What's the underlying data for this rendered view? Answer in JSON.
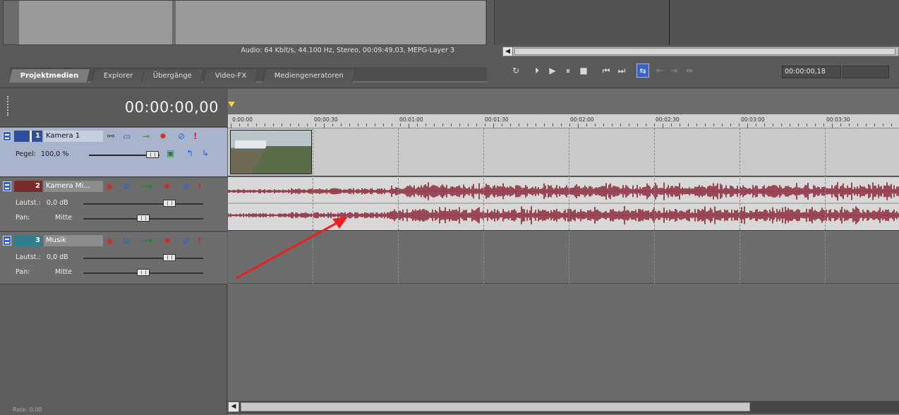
{
  "media": {
    "info": "Audio: 64 Kbit/s, 44.100 Hz, Stereo, 00:09:49,03, MEPG-Layer 3",
    "tabs": [
      {
        "label": "Projektmedien",
        "active": true
      },
      {
        "label": "Explorer",
        "active": false
      },
      {
        "label": "Übergänge",
        "active": false
      },
      {
        "label": "Video-FX",
        "active": false
      },
      {
        "label": "Mediengeneratoren",
        "active": false
      }
    ]
  },
  "preview": {
    "scroll_left_icon": "scroll-left-arrow-icon"
  },
  "transport": {
    "buttons": [
      {
        "name": "loop-playback-icon",
        "glyph": "↻"
      },
      {
        "name": "play-from-start-icon",
        "glyph": "⏵"
      },
      {
        "name": "play-icon",
        "glyph": "▶"
      },
      {
        "name": "pause-icon",
        "glyph": "⏸"
      },
      {
        "name": "stop-icon",
        "glyph": "■"
      },
      {
        "name": "go-to-start-icon",
        "glyph": "⏮"
      },
      {
        "name": "go-to-end-icon",
        "glyph": "⏭"
      },
      {
        "name": "loop-region-icon",
        "glyph": "⇆"
      },
      {
        "name": "prev-frame-icon",
        "glyph": "⇤"
      },
      {
        "name": "next-frame-icon",
        "glyph": "⇥"
      },
      {
        "name": "marker-icon",
        "glyph": "⇹"
      }
    ],
    "time": "00:00:00,18"
  },
  "timeline": {
    "cursor_time": "00:00:00,00",
    "ruler": [
      "0:00:00",
      "00:00:30",
      "00:01:00",
      "00:01:30",
      "00:02:00",
      "00:02:30",
      "00:03:00",
      "00:03:30"
    ]
  },
  "tracks": [
    {
      "number": "1",
      "name": "Kamera 1",
      "type": "video",
      "level_label": "Pegel:",
      "level_value": "100,0 %",
      "level_fraction": 0.9
    },
    {
      "number": "2",
      "name": "Kamera Mi...",
      "type": "audio",
      "volume_label": "Lautst.:",
      "volume_value": "0,0 dB",
      "volume_fraction": 0.72,
      "pan_label": "Pan:",
      "pan_value": "Mitte",
      "pan_fraction": 0.5
    },
    {
      "number": "3",
      "name": "Musik",
      "type": "audio",
      "volume_label": "Lautst.:",
      "volume_value": "0,0 dB",
      "volume_fraction": 0.72,
      "pan_label": "Pan:",
      "pan_value": "Mitte",
      "pan_fraction": 0.5
    }
  ],
  "colors": {
    "waveform": "#8b2434",
    "video_track_bg": "#a7b4cb",
    "annotation_arrow": "#e8231f",
    "loop_button": "#3b63c6"
  },
  "status": {
    "text": "Rate: 0,00"
  }
}
